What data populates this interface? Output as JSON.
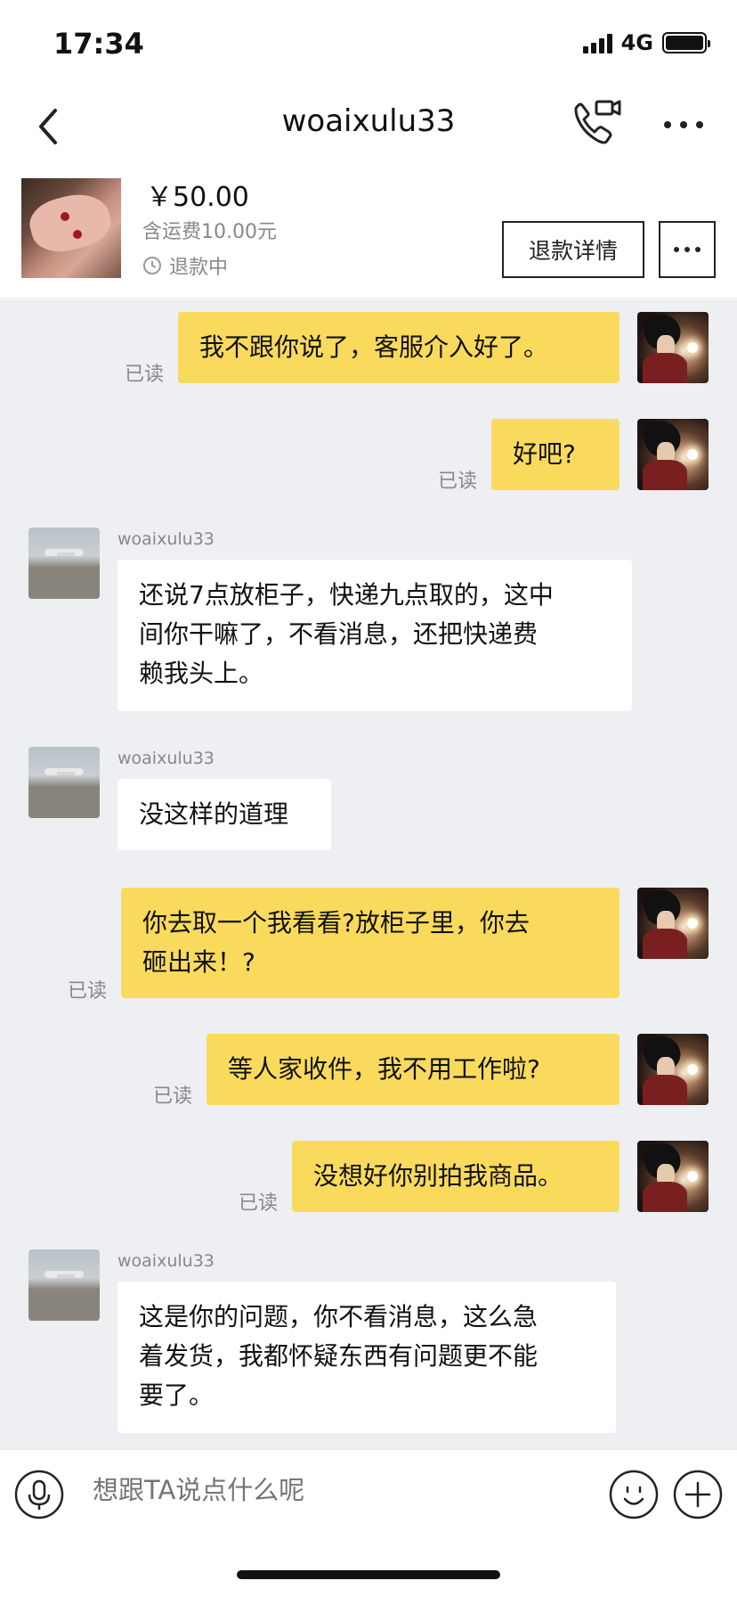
{
  "status_bar": {
    "time": "17:34",
    "network": "4G"
  },
  "header": {
    "title": "woaixulu33"
  },
  "product": {
    "price": "￥50.00",
    "shipping": "含运费10.00元",
    "status": "退款中",
    "refund_button": "退款详情"
  },
  "messages": [
    {
      "side": "me",
      "text": "我不跟你说了，客服介入好了。",
      "read": "已读"
    },
    {
      "side": "me",
      "text": "好吧?",
      "read": "已读"
    },
    {
      "side": "them",
      "sender": "woaixulu33",
      "line1": "还说7点放柜子，快递九点取的，这中",
      "line2": "间你干嘛了，不看消息，还把快递费",
      "line3": "赖我头上。"
    },
    {
      "side": "them",
      "sender": "woaixulu33",
      "line1": "没这样的道理"
    },
    {
      "side": "me",
      "line1": "你去取一个我看看?放柜子里，你去",
      "line2": "砸出来！?",
      "read": "已读"
    },
    {
      "side": "me",
      "text": "等人家收件，我不用工作啦?",
      "read": "已读"
    },
    {
      "side": "me",
      "text": "没想好你别拍我商品。",
      "read": "已读"
    },
    {
      "side": "them",
      "sender": "woaixulu33",
      "line1": "这是你的问题，你不看消息，这么急",
      "line2": "着发货，我都怀疑东西有问题更不能",
      "line3": "要了。"
    }
  ],
  "input": {
    "placeholder": "想跟TA说点什么呢"
  },
  "icons": {
    "back": "chevron-left-icon",
    "phone": "phone-video-icon",
    "more": "more-horizontal-icon",
    "clock": "clock-icon",
    "mic": "microphone-icon",
    "emoji": "smiley-icon",
    "plus": "plus-icon"
  },
  "colors": {
    "my_bubble": "#f9da5d",
    "chat_bg": "#eeeff3"
  }
}
